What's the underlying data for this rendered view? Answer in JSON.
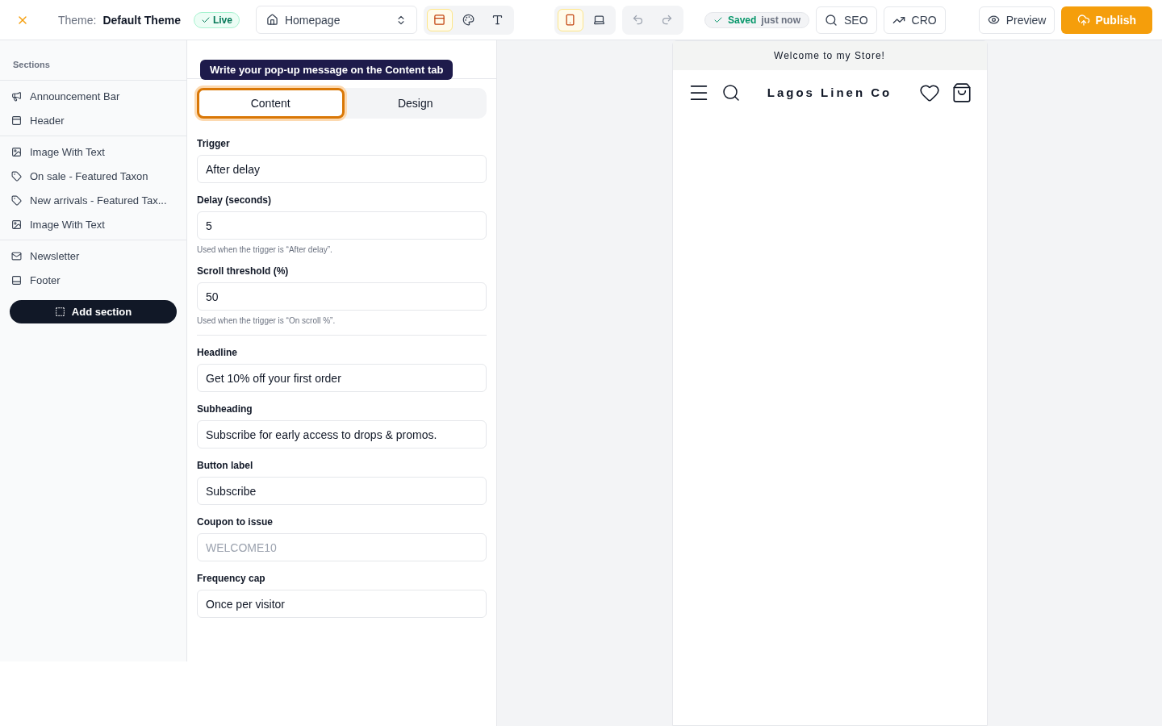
{
  "topbar": {
    "theme_label": "Theme:",
    "theme_name": "Default Theme",
    "status": "Live",
    "page_select": "Homepage",
    "tools": [
      {
        "kind": "sections",
        "selected": true
      },
      {
        "kind": "palette",
        "selected": false
      },
      {
        "kind": "typography",
        "selected": false
      }
    ],
    "devices": [
      {
        "kind": "mobile",
        "selected": true
      },
      {
        "kind": "desktop",
        "selected": false
      }
    ],
    "save_state": "Saved",
    "save_time": "just now",
    "actions": [
      {
        "kind": "search",
        "label": "SEO"
      },
      {
        "kind": "trend",
        "label": "CRO"
      }
    ],
    "preview": "Preview",
    "publish": "Publish"
  },
  "sidebar": {
    "title": "Sections",
    "groups": [
      [
        {
          "kind": "announcement",
          "label": "Announcement Bar"
        },
        {
          "kind": "header",
          "label": "Header"
        }
      ],
      [
        {
          "kind": "image",
          "label": "Image With Text"
        },
        {
          "kind": "products",
          "label": "On sale - Featured Taxon"
        },
        {
          "kind": "products",
          "label": "New arrivals - Featured Tax..."
        },
        {
          "kind": "image",
          "label": "Image With Text"
        }
      ],
      [
        {
          "kind": "newsletter",
          "label": "Newsletter"
        },
        {
          "kind": "footer",
          "label": "Footer"
        }
      ]
    ],
    "add_button": "Add section"
  },
  "editor": {
    "tooltip": "Write your pop-up message on the Content tab",
    "tabs": [
      {
        "label": "Content",
        "selected": true
      },
      {
        "label": "Design",
        "selected": false
      }
    ],
    "fields": [
      {
        "label": "Trigger",
        "value": "After delay"
      },
      {
        "label": "Delay (seconds)",
        "value": "5",
        "hint": "Used when the trigger is “After delay”."
      },
      {
        "label": "Scroll threshold (%)",
        "value": "50",
        "hint": "Used when the trigger is “On scroll %”.",
        "divider": true
      },
      {
        "label": "Headline",
        "value": "Get 10% off your first order"
      },
      {
        "label": "Subheading",
        "value": "Subscribe for early access to drops & promos."
      },
      {
        "label": "Button label",
        "value": "Subscribe"
      },
      {
        "label": "Coupon to issue",
        "placeholder": "WELCOME10"
      },
      {
        "label": "Frequency cap",
        "value": "Once per visitor"
      }
    ]
  },
  "preview": {
    "announcement": "Welcome to my Store!",
    "store_name": "Lagos Linen Co"
  }
}
